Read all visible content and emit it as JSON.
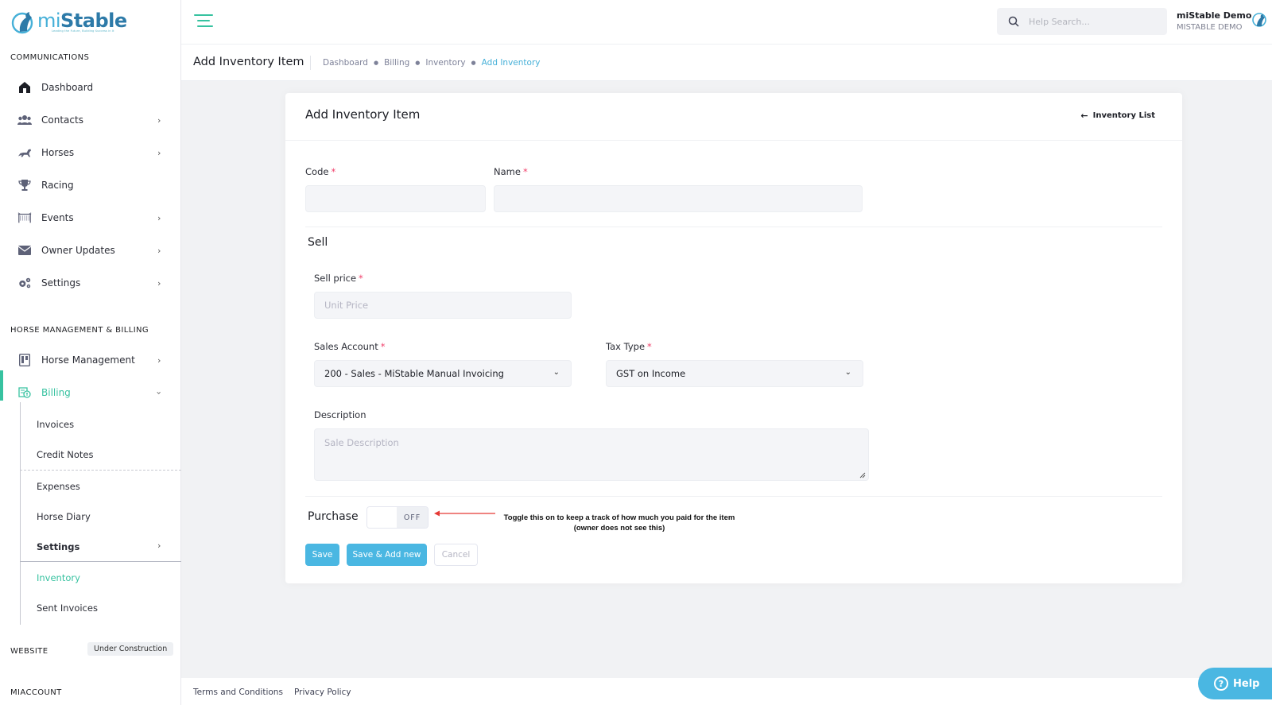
{
  "brand": {
    "name_prefix": "mi",
    "name_suffix": "Stable",
    "tagline": "Leading the Future, Building Success in It",
    "accent": "#37c2a0",
    "blue": "#4ab7e2"
  },
  "sidebar": {
    "section_communications": "COMMUNICATIONS",
    "section_horse_billing": "HORSE MANAGEMENT & BILLING",
    "section_website": "WEBSITE",
    "website_badge": "Under Construction",
    "section_miaccount": "MIACCOUNT",
    "communications_items": [
      {
        "label": "Dashboard",
        "icon": "home-icon"
      },
      {
        "label": "Contacts",
        "icon": "users-icon"
      },
      {
        "label": "Horses",
        "icon": "horse-icon"
      },
      {
        "label": "Racing",
        "icon": "trophy-icon"
      },
      {
        "label": "Events",
        "icon": "events-icon"
      },
      {
        "label": "Owner Updates",
        "icon": "envelope-icon"
      },
      {
        "label": "Settings",
        "icon": "gears-icon"
      }
    ],
    "billing_items": [
      {
        "label": "Horse Management",
        "icon": "clipboard-icon"
      },
      {
        "label": "Billing",
        "icon": "billing-icon"
      }
    ],
    "billing_sub": [
      "Invoices",
      "Credit Notes",
      "Expenses",
      "Horse Diary",
      "Settings",
      "Inventory",
      "Sent Invoices"
    ]
  },
  "topbar": {
    "search_placeholder": "Help Search...",
    "user_name": "miStable Demo",
    "user_org": "MISTABLE DEMO"
  },
  "subheader": {
    "title": "Add Inventory Item",
    "breadcrumb": [
      "Dashboard",
      "Billing",
      "Inventory",
      "Add Inventory"
    ]
  },
  "card": {
    "title": "Add Inventory Item",
    "back_link": "Inventory List",
    "code_label": "Code",
    "name_label": "Name",
    "code_value": "",
    "name_value": "",
    "sell_heading": "Sell",
    "sell_price_label": "Sell price",
    "sell_price_placeholder": "Unit Price",
    "sales_account_label": "Sales Account",
    "sales_account_value": "200 - Sales - MiStable Manual Invoicing",
    "tax_type_label": "Tax Type",
    "tax_type_value": "GST on Income",
    "description_label": "Description",
    "description_placeholder": "Sale Description",
    "purchase_heading": "Purchase",
    "purchase_toggle": "OFF",
    "annotation": "Toggle this on to keep a track of how much you paid for the item (owner does not see this)",
    "save_label": "Save",
    "save_add_label": "Save & Add new",
    "cancel_label": "Cancel"
  },
  "footer": {
    "terms": "Terms and Conditions",
    "privacy": "Privacy Policy"
  },
  "help": {
    "label": "Help"
  }
}
